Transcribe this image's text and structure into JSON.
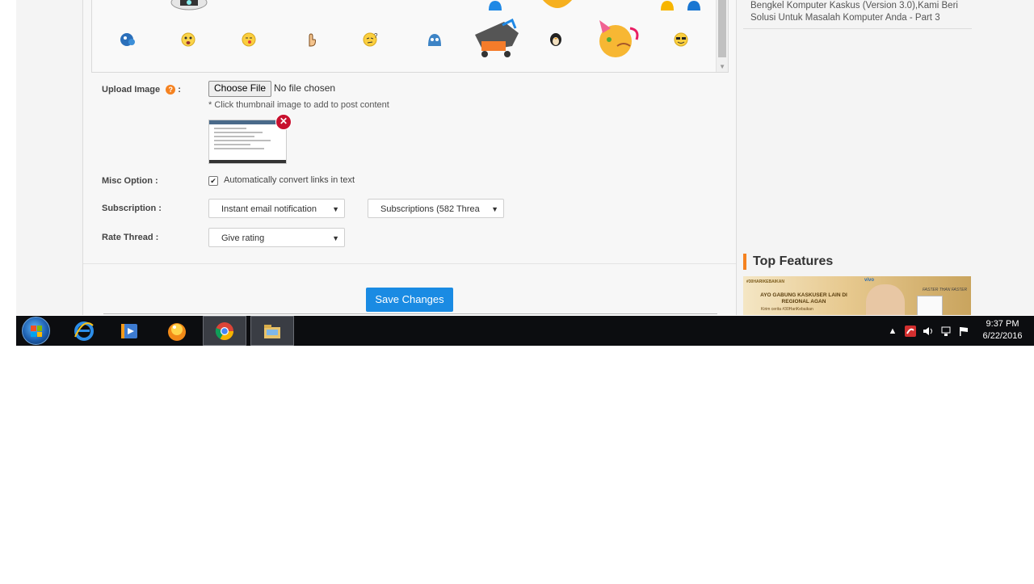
{
  "form": {
    "upload_label": "Upload Image",
    "help_glyph": "?",
    "label_suffix": ":",
    "choose_file_button": "Choose File",
    "file_status": "No file chosen",
    "thumbnail_hint": "* Click thumbnail image to add to post content",
    "misc_label": "Misc Option :",
    "misc_checkbox_label": "Automatically convert links in text",
    "misc_checked": true,
    "subscription_label": "Subscription :",
    "subscription_mode": "Instant email notification",
    "subscription_folder": "Subscriptions (582 Threa",
    "rate_label": "Rate Thread :",
    "rate_value": "Give rating",
    "save_button": "Save Changes"
  },
  "sidebar": {
    "related_link": "Bengkel Komputer Kaskus (Version 3.0),Kami Beri Solusi Untuk Masalah Komputer Anda - Part 3",
    "features_title": "Top Features",
    "banner_tag": "#30HARIKEBAIKAN",
    "banner_headline": "AYO GABUNG KASKUSER LAIN DI REGIONAL AGAN",
    "banner_sub": "Kirim cerita #30HariKebaikan",
    "banner_brand": "vivo",
    "banner_slogan": "FASTER THAN FASTER",
    "accent_color": "#f58220"
  },
  "taskbar": {
    "apps": [
      {
        "name": "internet-explorer",
        "active": false
      },
      {
        "name": "media-player",
        "active": false
      },
      {
        "name": "messenger",
        "active": false
      },
      {
        "name": "chrome",
        "active": true
      },
      {
        "name": "file-explorer",
        "active": true
      }
    ],
    "clock_time": "9:37 PM",
    "clock_date": "6/22/2016"
  },
  "colors": {
    "save_button_bg": "#1a8be3",
    "taskbar_bg": "#0c0d10"
  }
}
